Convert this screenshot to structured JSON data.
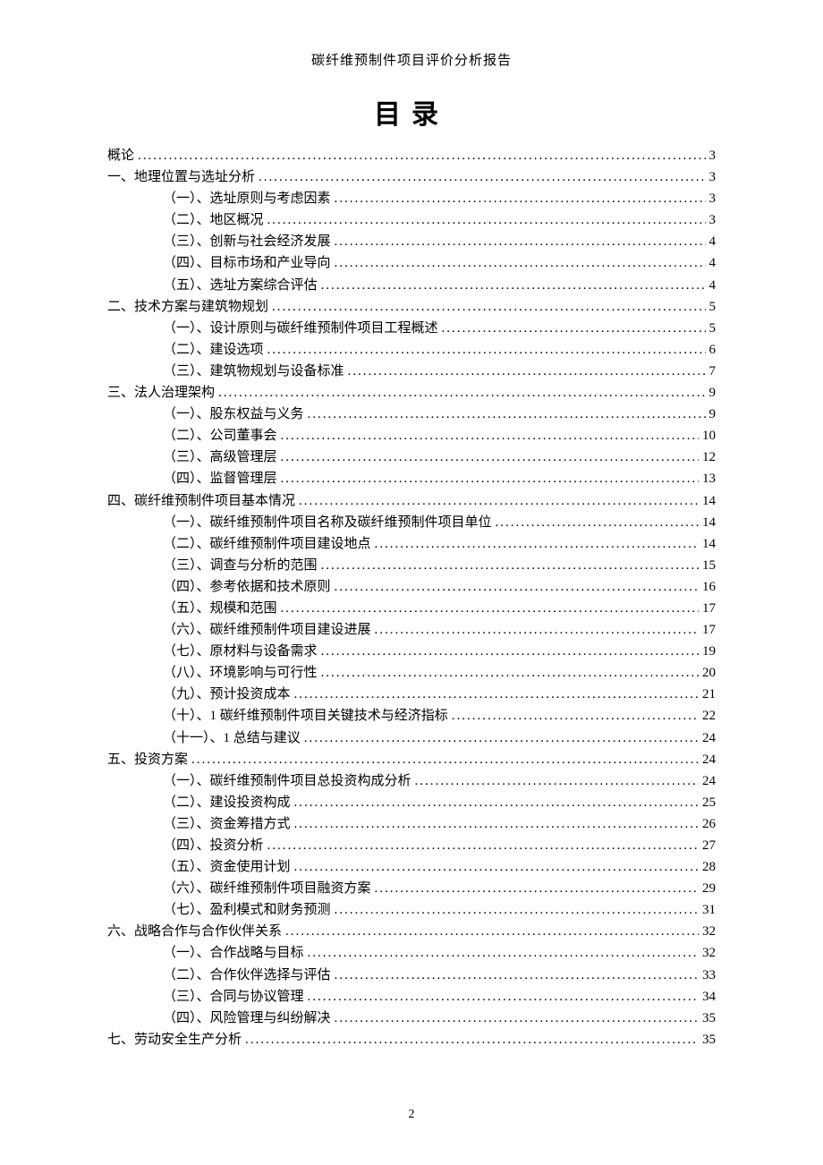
{
  "header": "碳纤维预制件项目评价分析报告",
  "tocTitle": "目录",
  "pageNumber": "2",
  "entries": [
    {
      "level": 1,
      "label": "概论",
      "page": "3"
    },
    {
      "level": 1,
      "label": "一、地理位置与选址分析",
      "page": "3"
    },
    {
      "level": 2,
      "label": "（一）、选址原则与考虑因素",
      "page": "3"
    },
    {
      "level": 2,
      "label": "（二）、地区概况",
      "page": "3"
    },
    {
      "level": 2,
      "label": "（三）、创新与社会经济发展",
      "page": "4"
    },
    {
      "level": 2,
      "label": "（四）、目标市场和产业导向",
      "page": "4"
    },
    {
      "level": 2,
      "label": "（五）、选址方案综合评估",
      "page": "4"
    },
    {
      "level": 1,
      "label": "二、技术方案与建筑物规划",
      "page": "5"
    },
    {
      "level": 2,
      "label": "（一）、设计原则与碳纤维预制件项目工程概述",
      "page": "5"
    },
    {
      "level": 2,
      "label": "（二）、建设选项",
      "page": "6"
    },
    {
      "level": 2,
      "label": "（三）、建筑物规划与设备标准",
      "page": "7"
    },
    {
      "level": 1,
      "label": "三、法人治理架构",
      "page": "9"
    },
    {
      "level": 2,
      "label": "（一）、股东权益与义务",
      "page": "9"
    },
    {
      "level": 2,
      "label": "（二）、公司董事会",
      "page": "10"
    },
    {
      "level": 2,
      "label": "（三）、高级管理层",
      "page": "12"
    },
    {
      "level": 2,
      "label": "（四）、监督管理层",
      "page": "13"
    },
    {
      "level": 1,
      "label": "四、碳纤维预制件项目基本情况",
      "page": "14"
    },
    {
      "level": 2,
      "label": "（一）、碳纤维预制件项目名称及碳纤维预制件项目单位",
      "page": "14"
    },
    {
      "level": 2,
      "label": "（二）、碳纤维预制件项目建设地点",
      "page": "14"
    },
    {
      "level": 2,
      "label": "（三）、调查与分析的范围",
      "page": "15"
    },
    {
      "level": 2,
      "label": "（四）、参考依据和技术原则",
      "page": "16"
    },
    {
      "level": 2,
      "label": "（五）、规模和范围",
      "page": "17"
    },
    {
      "level": 2,
      "label": "（六）、碳纤维预制件项目建设进展",
      "page": "17"
    },
    {
      "level": 2,
      "label": "（七）、原材料与设备需求",
      "page": "19"
    },
    {
      "level": 2,
      "label": "（八）、环境影响与可行性",
      "page": "20"
    },
    {
      "level": 2,
      "label": "（九）、预计投资成本",
      "page": "21"
    },
    {
      "level": 2,
      "label": "（十）、1 碳纤维预制件项目关键技术与经济指标",
      "page": "22"
    },
    {
      "level": 2,
      "label": "（十一）、1 总结与建议",
      "page": "24"
    },
    {
      "level": 1,
      "label": "五、投资方案",
      "page": "24"
    },
    {
      "level": 2,
      "label": "（一）、碳纤维预制件项目总投资构成分析",
      "page": "24"
    },
    {
      "level": 2,
      "label": "（二）、建设投资构成",
      "page": "25"
    },
    {
      "level": 2,
      "label": "（三）、资金筹措方式",
      "page": "26"
    },
    {
      "level": 2,
      "label": "（四）、投资分析",
      "page": "27"
    },
    {
      "level": 2,
      "label": "（五）、资金使用计划",
      "page": "28"
    },
    {
      "level": 2,
      "label": "（六）、碳纤维预制件项目融资方案",
      "page": "29"
    },
    {
      "level": 2,
      "label": "（七）、盈利模式和财务预测",
      "page": "31"
    },
    {
      "level": 1,
      "label": "六、战略合作与合作伙伴关系",
      "page": "32"
    },
    {
      "level": 2,
      "label": "（一）、合作战略与目标",
      "page": "32"
    },
    {
      "level": 2,
      "label": "（二）、合作伙伴选择与评估",
      "page": "33"
    },
    {
      "level": 2,
      "label": "（三）、合同与协议管理",
      "page": "34"
    },
    {
      "level": 2,
      "label": "（四）、风险管理与纠纷解决",
      "page": "35"
    },
    {
      "level": 1,
      "label": "七、劳动安全生产分析",
      "page": "35"
    }
  ]
}
